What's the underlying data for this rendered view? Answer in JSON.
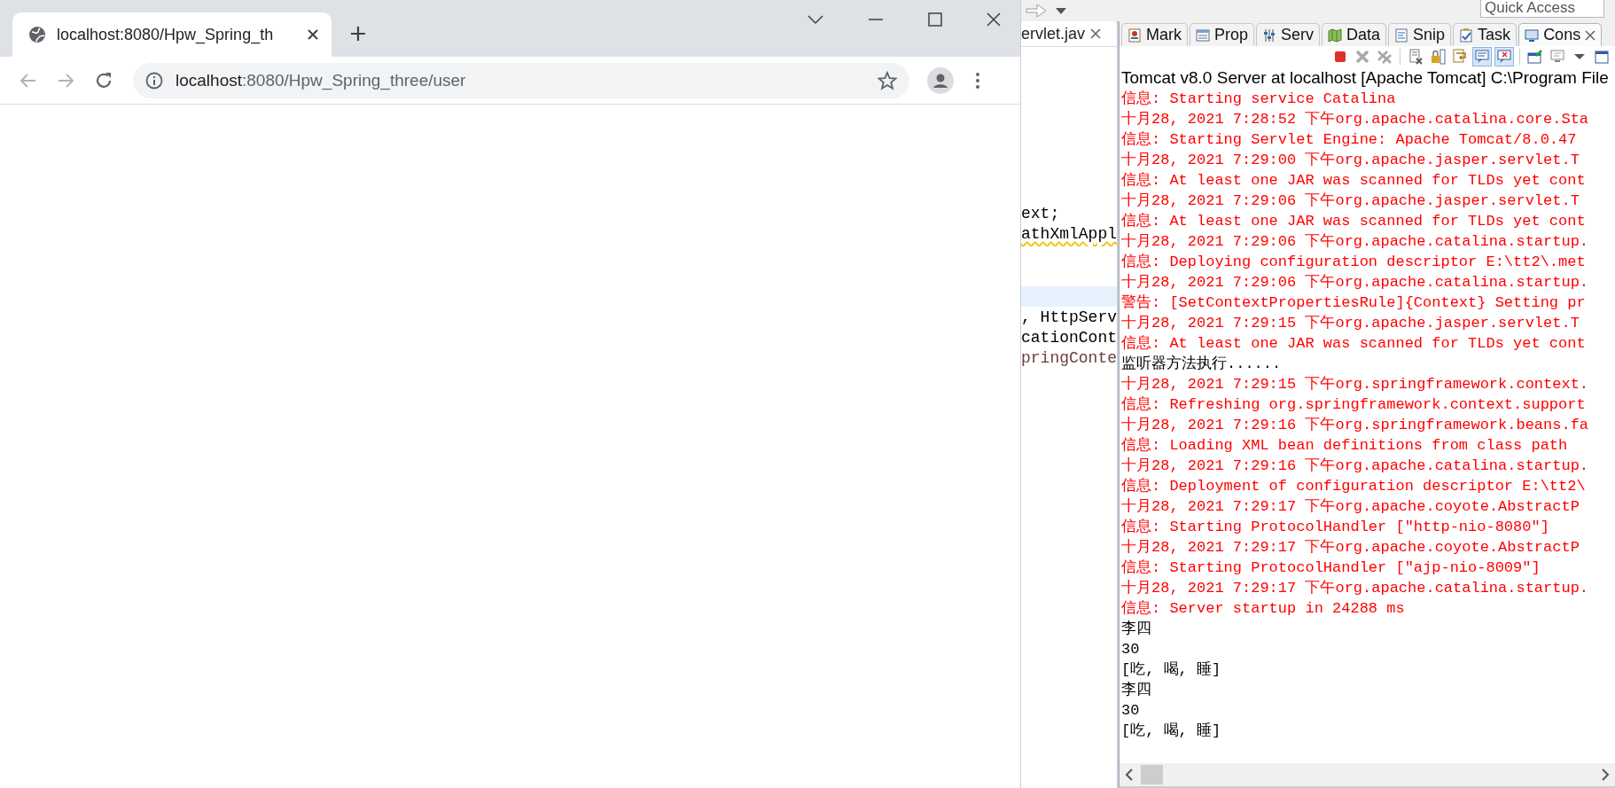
{
  "browser": {
    "tab": {
      "title": "localhost:8080/Hpw_Spring_th",
      "selected": true
    },
    "address": {
      "host": "localhost",
      "path": ":8080/Hpw_Spring_three/user"
    }
  },
  "ide": {
    "quick_access": {
      "placeholder": "Quick Access"
    },
    "editor": {
      "tab": "ervlet.jav",
      "lines": [
        {
          "text": "ext;",
          "kind": "plain",
          "warning": false
        },
        {
          "text": "athXmlAppl",
          "kind": "plain",
          "warning": true
        },
        {
          "text": ", HttpServ",
          "kind": "plain",
          "warning": false
        },
        {
          "text": "cationCont",
          "kind": "plain",
          "warning": false
        },
        {
          "text": "pringConte",
          "kind": "local",
          "warning": false
        }
      ]
    },
    "views": [
      {
        "label": "Mark",
        "kind": "markers",
        "selected": false
      },
      {
        "label": "Prop",
        "kind": "properties",
        "selected": false
      },
      {
        "label": "Serv",
        "kind": "servers",
        "selected": false
      },
      {
        "label": "Data",
        "kind": "data",
        "selected": false
      },
      {
        "label": "Snip",
        "kind": "snippets",
        "selected": false
      },
      {
        "label": "Task",
        "kind": "tasks",
        "selected": false
      },
      {
        "label": "Cons",
        "kind": "console",
        "selected": true
      }
    ],
    "toolbar": [
      {
        "kind": "stop",
        "on": false
      },
      {
        "kind": "remove",
        "on": false
      },
      {
        "kind": "remove-all",
        "on": false
      },
      {
        "kind": "clear",
        "on": false
      },
      {
        "kind": "scroll-lock",
        "on": false
      },
      {
        "kind": "word-wrap",
        "on": false
      },
      {
        "kind": "stdout",
        "on": true
      },
      {
        "kind": "stderr",
        "on": true
      },
      {
        "kind": "pin",
        "on": false
      },
      {
        "kind": "display",
        "on": false
      },
      {
        "kind": "menu",
        "on": false
      },
      {
        "kind": "new",
        "on": false
      }
    ],
    "console_title": "Tomcat v8.0 Server at localhost [Apache Tomcat] C:\\Program File",
    "output": [
      {
        "text": "信息: Starting service Catalina",
        "kind": "stderr"
      },
      {
        "text": "十月28, 2021 7:28:52 下午org.apache.catalina.core.Sta",
        "kind": "stderr"
      },
      {
        "text": "信息: Starting Servlet Engine: Apache Tomcat/8.0.47",
        "kind": "stderr"
      },
      {
        "text": "十月28, 2021 7:29:00 下午org.apache.jasper.servlet.T",
        "kind": "stderr"
      },
      {
        "text": "信息: At least one JAR was scanned for TLDs yet cont",
        "kind": "stderr"
      },
      {
        "text": "十月28, 2021 7:29:06 下午org.apache.jasper.servlet.T",
        "kind": "stderr"
      },
      {
        "text": "信息: At least one JAR was scanned for TLDs yet cont",
        "kind": "stderr"
      },
      {
        "text": "十月28, 2021 7:29:06 下午org.apache.catalina.startup.",
        "kind": "stderr"
      },
      {
        "text": "信息: Deploying configuration descriptor E:\\tt2\\.met",
        "kind": "stderr"
      },
      {
        "text": "十月28, 2021 7:29:06 下午org.apache.catalina.startup.",
        "kind": "stderr"
      },
      {
        "text": "警告: [SetContextPropertiesRule]{Context} Setting pr",
        "kind": "stderr"
      },
      {
        "text": "十月28, 2021 7:29:15 下午org.apache.jasper.servlet.T",
        "kind": "stderr"
      },
      {
        "text": "信息: At least one JAR was scanned for TLDs yet cont",
        "kind": "stderr"
      },
      {
        "text": "监听器方法执行......",
        "kind": "stdout"
      },
      {
        "text": "十月28, 2021 7:29:15 下午org.springframework.context.",
        "kind": "stderr"
      },
      {
        "text": "信息: Refreshing org.springframework.context.support",
        "kind": "stderr"
      },
      {
        "text": "十月28, 2021 7:29:16 下午org.springframework.beans.fa",
        "kind": "stderr"
      },
      {
        "text": "信息: Loading XML bean definitions from class path",
        "kind": "stderr"
      },
      {
        "text": "十月28, 2021 7:29:16 下午org.apache.catalina.startup.",
        "kind": "stderr"
      },
      {
        "text": "信息: Deployment of configuration descriptor E:\\tt2\\",
        "kind": "stderr"
      },
      {
        "text": "十月28, 2021 7:29:17 下午org.apache.coyote.AbstractP",
        "kind": "stderr"
      },
      {
        "text": "信息: Starting ProtocolHandler [\"http-nio-8080\"]",
        "kind": "stderr"
      },
      {
        "text": "十月28, 2021 7:29:17 下午org.apache.coyote.AbstractP",
        "kind": "stderr"
      },
      {
        "text": "信息: Starting ProtocolHandler [\"ajp-nio-8009\"]",
        "kind": "stderr"
      },
      {
        "text": "十月28, 2021 7:29:17 下午org.apache.catalina.startup.",
        "kind": "stderr"
      },
      {
        "text": "信息: Server startup in 24288 ms",
        "kind": "stderr"
      },
      {
        "text": "李四",
        "kind": "stdout"
      },
      {
        "text": "30",
        "kind": "stdout"
      },
      {
        "text": "[吃, 喝, 睡]",
        "kind": "stdout"
      },
      {
        "text": "李四",
        "kind": "stdout"
      },
      {
        "text": "30",
        "kind": "stdout"
      },
      {
        "text": "[吃, 喝, 睡]",
        "kind": "stdout"
      }
    ]
  }
}
